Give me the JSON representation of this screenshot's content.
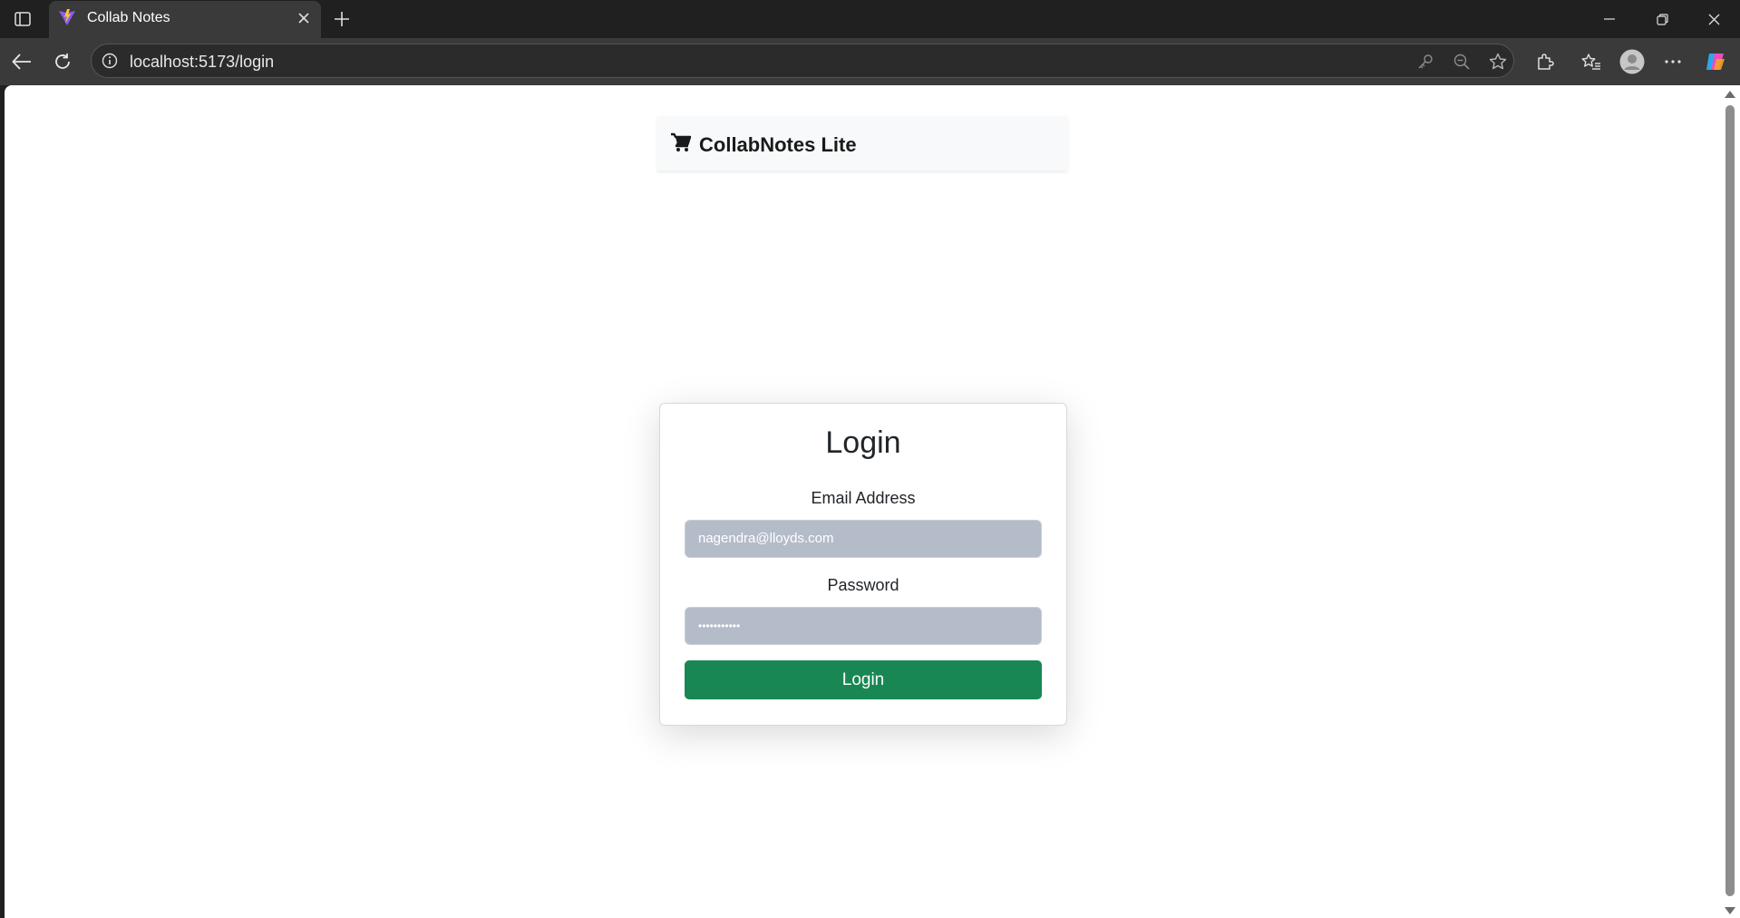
{
  "browser": {
    "tab": {
      "title": "Collab Notes",
      "favicon": "vite-logo-icon"
    },
    "url": "localhost:5173/login",
    "colors": {
      "frame": "#202020",
      "toolbar": "#3a3a3a"
    }
  },
  "app": {
    "brand": {
      "name": "CollabNotes Lite",
      "icon": "cart-icon"
    },
    "login": {
      "title": "Login",
      "email_label": "Email Address",
      "email_value": "nagendra@lloyds.com",
      "password_label": "Password",
      "password_mask": "•••••••••••",
      "button_label": "Login"
    },
    "colors": {
      "primary_button": "#198754",
      "input_background": "#b5bcc9"
    }
  }
}
